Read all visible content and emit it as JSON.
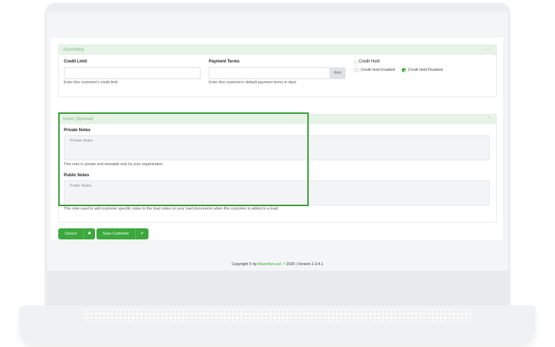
{
  "accounting": {
    "section_title": "Accounting",
    "credit_limit_label": "Credit Limit",
    "credit_limit_value": "",
    "credit_limit_help": "Enter this customer's credit limit",
    "payment_terms_label": "Payment Terms",
    "payment_terms_value": "",
    "payment_terms_addon": "days",
    "payment_terms_help": "Enter this customer's default payment terms in days",
    "credit_hold_label": "Credit Hold",
    "credit_hold_options": [
      "Credit Hold Enabled",
      "Credit Hold Disabled"
    ],
    "credit_hold_selected": "Credit Hold Disabled"
  },
  "notes": {
    "section_title": "Notes (Optional)",
    "private_label": "Private Notes",
    "private_placeholder": "Private Notes",
    "private_help": "This note is private and viewable only by your organization.",
    "public_label": "Public Notes",
    "public_placeholder": "Public Notes",
    "public_help": "This note used to add customer specific notes to the load notes on your load documents when this customer is added to a load."
  },
  "actions": {
    "cancel_label": "Cancel",
    "save_label": "Save Customer"
  },
  "footer": {
    "prefix": "Copyright © by",
    "brand": "MakeMyLoad",
    "suffix": "2025 | Version 2.3.4.1"
  },
  "colors": {
    "accent": "#3da83d",
    "section_header_bg": "#e6f3e6",
    "highlight_border": "#2e9a2e"
  },
  "icons": {
    "collapse": "chevron-up-icon",
    "help": "help-circle-icon",
    "cancel": "close-icon",
    "save": "check-icon",
    "external": "external-link-icon"
  }
}
